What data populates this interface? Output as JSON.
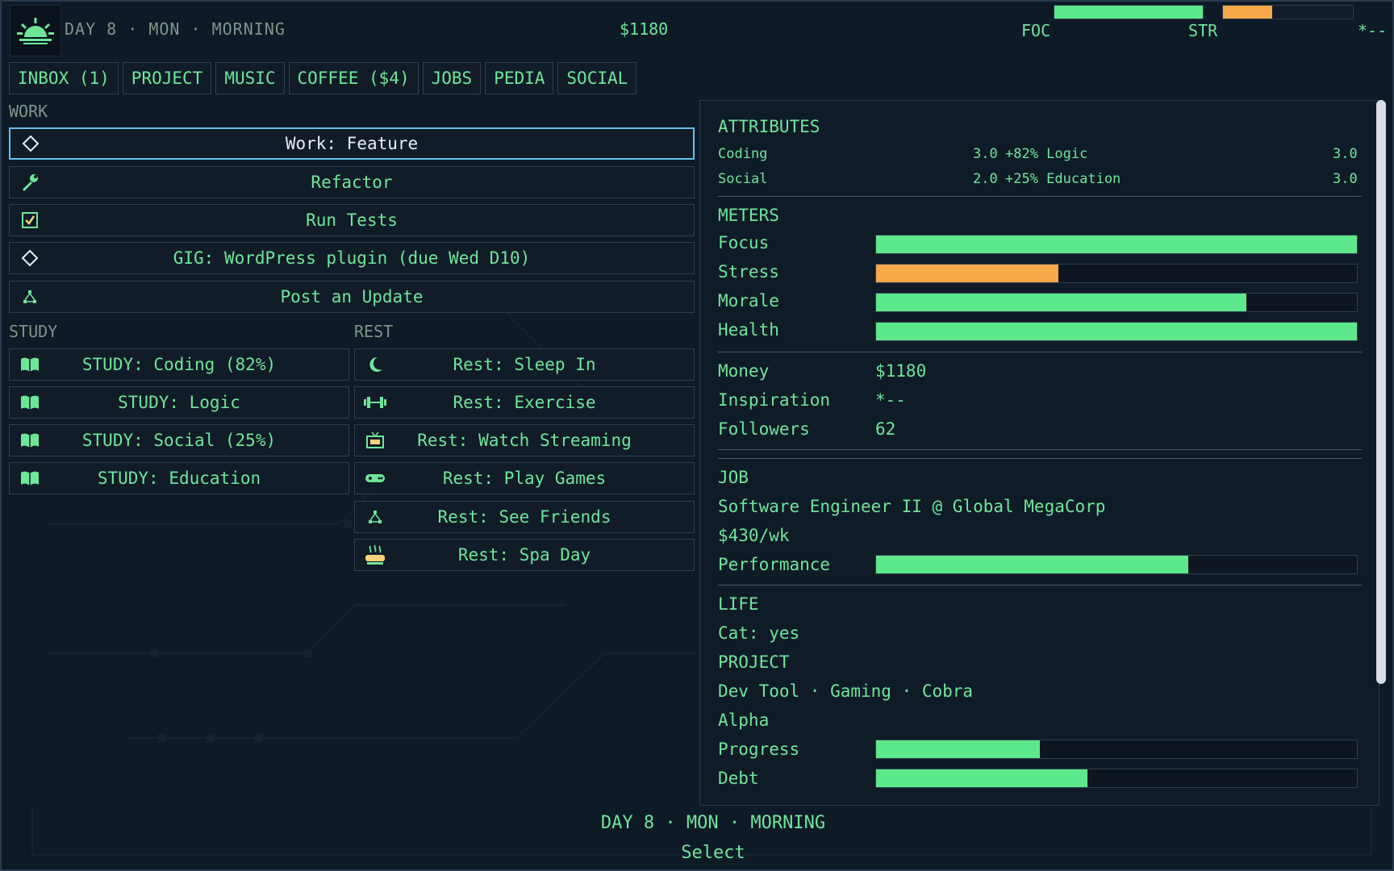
{
  "topbar": {
    "day_label": "DAY 8 · MON · MORNING",
    "money": "$1180",
    "foc_label": "FOC",
    "str_label": "STR",
    "inspiration": "*--",
    "focus_fraction": 1.0,
    "stress_fraction": 0.38
  },
  "tabs": [
    {
      "label": "INBOX (1)"
    },
    {
      "label": "PROJECT"
    },
    {
      "label": "MUSIC"
    },
    {
      "label": "COFFEE ($4)"
    },
    {
      "label": "JOBS"
    },
    {
      "label": "PEDIA"
    },
    {
      "label": "SOCIAL"
    }
  ],
  "sections": {
    "work": "WORK",
    "study": "STUDY",
    "rest": "REST"
  },
  "work_actions": [
    {
      "label": "Work: Feature",
      "icon": "diamond-icon"
    },
    {
      "label": "Refactor",
      "icon": "wrench-icon"
    },
    {
      "label": "Run Tests",
      "icon": "checkbox-icon"
    },
    {
      "label": "GIG: WordPress plugin (due Wed D10)",
      "icon": "diamond-icon"
    },
    {
      "label": "Post an Update",
      "icon": "network-icon"
    }
  ],
  "study_actions": [
    {
      "label": "STUDY: Coding (82%)",
      "icon": "book-icon"
    },
    {
      "label": "STUDY: Logic",
      "icon": "book-icon"
    },
    {
      "label": "STUDY: Social (25%)",
      "icon": "book-icon"
    },
    {
      "label": "STUDY: Education",
      "icon": "book-icon"
    }
  ],
  "rest_actions": [
    {
      "label": "Rest: Sleep In",
      "icon": "moon-icon"
    },
    {
      "label": "Rest: Exercise",
      "icon": "dumbbell-icon"
    },
    {
      "label": "Rest: Watch Streaming",
      "icon": "tv-icon"
    },
    {
      "label": "Rest: Play Games",
      "icon": "gamepad-icon"
    },
    {
      "label": "Rest: See Friends",
      "icon": "network-icon"
    },
    {
      "label": "Rest: Spa Day",
      "icon": "spa-icon"
    }
  ],
  "panel": {
    "attributes_title": "ATTRIBUTES",
    "attributes": [
      {
        "name": "Coding",
        "value": "3.0",
        "bonus": "+82% Logic",
        "value2": "3.0"
      },
      {
        "name": "Social",
        "value": "2.0",
        "bonus": "+25% Education",
        "value2": "3.0"
      }
    ],
    "meters_title": "METERS",
    "meters": [
      {
        "name": "Focus",
        "fraction": 1.0,
        "color": "#5de88b"
      },
      {
        "name": "Stress",
        "fraction": 0.38,
        "color": "#f6a84a"
      },
      {
        "name": "Morale",
        "fraction": 0.77,
        "color": "#5de88b"
      },
      {
        "name": "Health",
        "fraction": 1.0,
        "color": "#5de88b"
      }
    ],
    "money_label": "Money",
    "money_value": "$1180",
    "inspiration_label": "Inspiration",
    "inspiration_value": "*--",
    "followers_label": "Followers",
    "followers_value": "62",
    "job_title": "JOB",
    "job_name": "Software Engineer II @ Global MegaCorp",
    "job_pay": "$430/wk",
    "performance_label": "Performance",
    "performance_fraction": 0.65,
    "life_title": "LIFE",
    "life_cat": "Cat: yes",
    "project_title": "PROJECT",
    "project_name": "Dev Tool · Gaming · Cobra",
    "project_stage": "Alpha",
    "progress_label": "Progress",
    "progress_fraction": 0.34,
    "debt_label": "Debt",
    "debt_fraction": 0.44
  },
  "footer": {
    "day_label": "DAY 8 · MON · MORNING",
    "select_label": "Select"
  }
}
